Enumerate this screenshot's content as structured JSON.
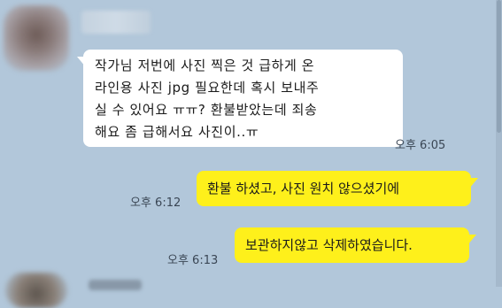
{
  "messages": [
    {
      "direction": "received",
      "lines": [
        "작가님 저번에 사진 찍은 것 급하게 온",
        "라인용 사진 jpg 필요한데 혹시 보내주",
        "실 수 있어요 ㅠㅠ? 환불받았는데 죄송",
        "해요 좀 급해서요 사진이..ㅠ"
      ],
      "time": "오후 6:05"
    },
    {
      "direction": "sent",
      "text": "환불 하셨고, 사진 원치 않으셨기에",
      "time": "오후 6:12"
    },
    {
      "direction": "sent",
      "text": "보관하지않고 삭제하였습니다.",
      "time": "오후 6:13"
    }
  ],
  "colors": {
    "background": "#b2c7da",
    "received_bubble": "#ffffff",
    "sent_bubble": "#fef01b"
  }
}
